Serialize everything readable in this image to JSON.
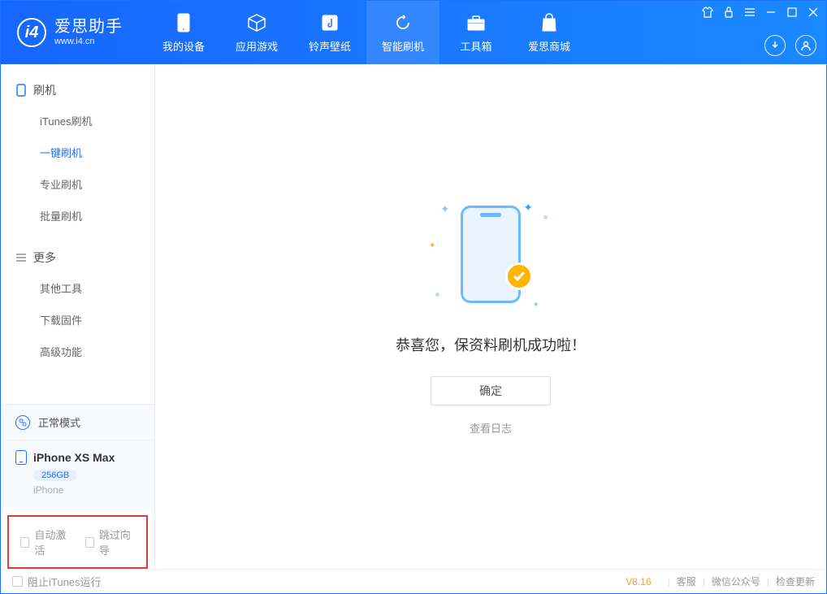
{
  "app": {
    "title": "爱思助手",
    "url": "www.i4.cn"
  },
  "nav": [
    {
      "id": "device",
      "label": "我的设备"
    },
    {
      "id": "apps",
      "label": "应用游戏"
    },
    {
      "id": "ring",
      "label": "铃声壁纸"
    },
    {
      "id": "flash",
      "label": "智能刷机"
    },
    {
      "id": "tools",
      "label": "工具箱"
    },
    {
      "id": "store",
      "label": "爱思商城"
    }
  ],
  "sidebar": {
    "flash_header": "刷机",
    "flash_items": [
      {
        "id": "itunes",
        "label": "iTunes刷机"
      },
      {
        "id": "onekey",
        "label": "一键刷机"
      },
      {
        "id": "pro",
        "label": "专业刷机"
      },
      {
        "id": "batch",
        "label": "批量刷机"
      }
    ],
    "more_header": "更多",
    "more_items": [
      {
        "id": "other",
        "label": "其他工具"
      },
      {
        "id": "firmware",
        "label": "下载固件"
      },
      {
        "id": "advanced",
        "label": "高级功能"
      }
    ]
  },
  "device": {
    "mode": "正常模式",
    "name": "iPhone XS Max",
    "storage": "256GB",
    "type": "iPhone"
  },
  "options": {
    "auto_activate": "自动激活",
    "skip_guide": "跳过向导"
  },
  "main": {
    "success": "恭喜您，保资料刷机成功啦！",
    "confirm": "确定",
    "view_log": "查看日志"
  },
  "footer": {
    "block_itunes": "阻止iTunes运行",
    "version": "V8.16",
    "links": [
      "客服",
      "微信公众号",
      "检查更新"
    ]
  }
}
